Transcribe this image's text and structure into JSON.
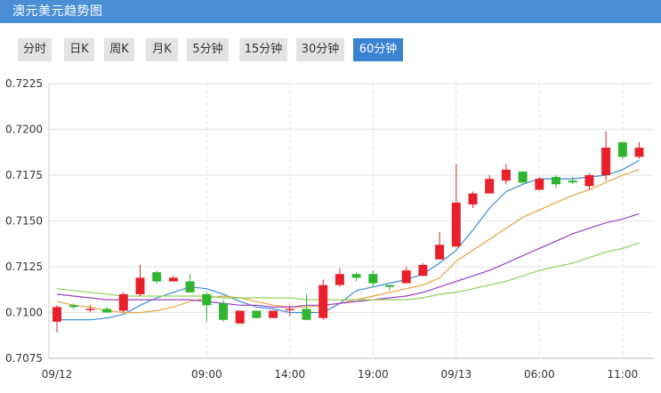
{
  "header": {
    "title": "澳元美元趋势图"
  },
  "tabs": [
    {
      "label": "分时",
      "active": false
    },
    {
      "label": "日K",
      "active": false
    },
    {
      "label": "周K",
      "active": false
    },
    {
      "label": "月K",
      "active": false
    },
    {
      "label": "5分钟",
      "active": false
    },
    {
      "label": "15分钟",
      "active": false
    },
    {
      "label": "30分钟",
      "active": false
    },
    {
      "label": "60分钟",
      "active": true
    }
  ],
  "colors": {
    "header_bg": "#4a8fd6",
    "tab_active": "#3b82d0",
    "up_candle": "#e8202a",
    "down_candle": "#2fb52f",
    "ma5": "#3a8ad6",
    "ma10": "#e8a040",
    "ma20": "#9b3fc8",
    "ma30": "#8fd25a"
  },
  "chart_data": {
    "type": "candlestick",
    "ylim": [
      0.7075,
      0.7225
    ],
    "y_ticks": [
      "0.7225",
      "0.7200",
      "0.7175",
      "0.7150",
      "0.7125",
      "0.7100",
      "0.7075"
    ],
    "x_ticks": [
      {
        "label": "09/12",
        "index": 0
      },
      {
        "label": "09:00",
        "index": 9
      },
      {
        "label": "14:00",
        "index": 14
      },
      {
        "label": "19:00",
        "index": 19
      },
      {
        "label": "09/13",
        "index": 24
      },
      {
        "label": "06:00",
        "index": 29
      },
      {
        "label": "11:00",
        "index": 34
      }
    ],
    "candles": [
      {
        "o": 0.7095,
        "c": 0.7103,
        "h": 0.7104,
        "l": 0.7089
      },
      {
        "o": 0.7104,
        "c": 0.7103,
        "h": 0.7105,
        "l": 0.7102
      },
      {
        "o": 0.7102,
        "c": 0.7102,
        "h": 0.7104,
        "l": 0.71
      },
      {
        "o": 0.7102,
        "c": 0.71,
        "h": 0.7103,
        "l": 0.71
      },
      {
        "o": 0.7101,
        "c": 0.711,
        "h": 0.7111,
        "l": 0.71
      },
      {
        "o": 0.711,
        "c": 0.7119,
        "h": 0.7126,
        "l": 0.7109
      },
      {
        "o": 0.7122,
        "c": 0.7117,
        "h": 0.7123,
        "l": 0.7116
      },
      {
        "o": 0.7117,
        "c": 0.7119,
        "h": 0.712,
        "l": 0.7117
      },
      {
        "o": 0.7117,
        "c": 0.7111,
        "h": 0.7121,
        "l": 0.7111
      },
      {
        "o": 0.711,
        "c": 0.7104,
        "h": 0.7111,
        "l": 0.7095
      },
      {
        "o": 0.7105,
        "c": 0.7096,
        "h": 0.7107,
        "l": 0.7095
      },
      {
        "o": 0.7094,
        "c": 0.7101,
        "h": 0.7101,
        "l": 0.7094
      },
      {
        "o": 0.7101,
        "c": 0.7097,
        "h": 0.7101,
        "l": 0.7097
      },
      {
        "o": 0.7097,
        "c": 0.7101,
        "h": 0.7101,
        "l": 0.7097
      },
      {
        "o": 0.7102,
        "c": 0.7102,
        "h": 0.7104,
        "l": 0.7098
      },
      {
        "o": 0.7102,
        "c": 0.7096,
        "h": 0.711,
        "l": 0.7096
      },
      {
        "o": 0.7097,
        "c": 0.7115,
        "h": 0.7118,
        "l": 0.7096
      },
      {
        "o": 0.7115,
        "c": 0.7121,
        "h": 0.7124,
        "l": 0.7114
      },
      {
        "o": 0.7121,
        "c": 0.7119,
        "h": 0.7122,
        "l": 0.7117
      },
      {
        "o": 0.7121,
        "c": 0.7116,
        "h": 0.7123,
        "l": 0.7114
      },
      {
        "o": 0.7115,
        "c": 0.7114,
        "h": 0.7115,
        "l": 0.7112
      },
      {
        "o": 0.7116,
        "c": 0.7123,
        "h": 0.7125,
        "l": 0.7116
      },
      {
        "o": 0.712,
        "c": 0.7126,
        "h": 0.7127,
        "l": 0.712
      },
      {
        "o": 0.7129,
        "c": 0.7137,
        "h": 0.7144,
        "l": 0.7129
      },
      {
        "o": 0.7136,
        "c": 0.716,
        "h": 0.7181,
        "l": 0.7136
      },
      {
        "o": 0.7159,
        "c": 0.7165,
        "h": 0.7166,
        "l": 0.7157
      },
      {
        "o": 0.7165,
        "c": 0.7173,
        "h": 0.7175,
        "l": 0.7165
      },
      {
        "o": 0.7172,
        "c": 0.7178,
        "h": 0.7181,
        "l": 0.717
      },
      {
        "o": 0.7177,
        "c": 0.7171,
        "h": 0.7177,
        "l": 0.717
      },
      {
        "o": 0.7167,
        "c": 0.7173,
        "h": 0.7174,
        "l": 0.7167
      },
      {
        "o": 0.7174,
        "c": 0.717,
        "h": 0.7175,
        "l": 0.7168
      },
      {
        "o": 0.7172,
        "c": 0.7171,
        "h": 0.7174,
        "l": 0.717
      },
      {
        "o": 0.7169,
        "c": 0.7175,
        "h": 0.7176,
        "l": 0.7167
      },
      {
        "o": 0.7175,
        "c": 0.719,
        "h": 0.7199,
        "l": 0.7172
      },
      {
        "o": 0.7193,
        "c": 0.7185,
        "h": 0.7193,
        "l": 0.7184
      },
      {
        "o": 0.7185,
        "c": 0.719,
        "h": 0.7193,
        "l": 0.7184
      }
    ],
    "series": [
      {
        "key": "ma5",
        "color": "#3a8ad6",
        "values": [
          0.7096,
          0.7096,
          0.7096,
          0.7097,
          0.7099,
          0.7104,
          0.7108,
          0.7111,
          0.7114,
          0.7113,
          0.711,
          0.7106,
          0.7103,
          0.7102,
          0.71,
          0.71,
          0.71,
          0.7105,
          0.7112,
          0.7114,
          0.7116,
          0.7118,
          0.7121,
          0.7127,
          0.7134,
          0.7145,
          0.7157,
          0.7166,
          0.717,
          0.7173,
          0.7173,
          0.7173,
          0.7174,
          0.7175,
          0.7178,
          0.7183
        ]
      },
      {
        "key": "ma10",
        "color": "#e8a040",
        "values": [
          0.7106,
          0.7104,
          0.7103,
          0.7101,
          0.71,
          0.71,
          0.7101,
          0.7103,
          0.7106,
          0.7108,
          0.7109,
          0.7108,
          0.7106,
          0.7104,
          0.7103,
          0.7103,
          0.7104,
          0.7105,
          0.7107,
          0.7109,
          0.7111,
          0.7113,
          0.7115,
          0.7119,
          0.7128,
          0.7134,
          0.714,
          0.7146,
          0.7152,
          0.7156,
          0.716,
          0.7164,
          0.7167,
          0.7171,
          0.7175,
          0.7178
        ]
      },
      {
        "key": "ma20",
        "color": "#9b3fc8",
        "values": [
          0.711,
          0.7109,
          0.7108,
          0.7107,
          0.7107,
          0.7107,
          0.7107,
          0.7107,
          0.7107,
          0.7106,
          0.7105,
          0.7104,
          0.7104,
          0.7103,
          0.7103,
          0.7104,
          0.7104,
          0.7105,
          0.7106,
          0.7107,
          0.7108,
          0.7109,
          0.7111,
          0.7114,
          0.7117,
          0.712,
          0.7123,
          0.7127,
          0.7131,
          0.7135,
          0.7139,
          0.7143,
          0.7146,
          0.7149,
          0.7151,
          0.7154
        ]
      },
      {
        "key": "ma30",
        "color": "#8fd25a",
        "values": [
          0.7113,
          0.7112,
          0.7111,
          0.711,
          0.7109,
          0.7109,
          0.7109,
          0.7109,
          0.7109,
          0.7109,
          0.7108,
          0.7108,
          0.7108,
          0.7108,
          0.7108,
          0.7107,
          0.7107,
          0.7107,
          0.7107,
          0.7107,
          0.7107,
          0.7107,
          0.7108,
          0.711,
          0.7111,
          0.7113,
          0.7115,
          0.7117,
          0.712,
          0.7123,
          0.7125,
          0.7127,
          0.713,
          0.7133,
          0.7135,
          0.7138
        ]
      }
    ]
  }
}
